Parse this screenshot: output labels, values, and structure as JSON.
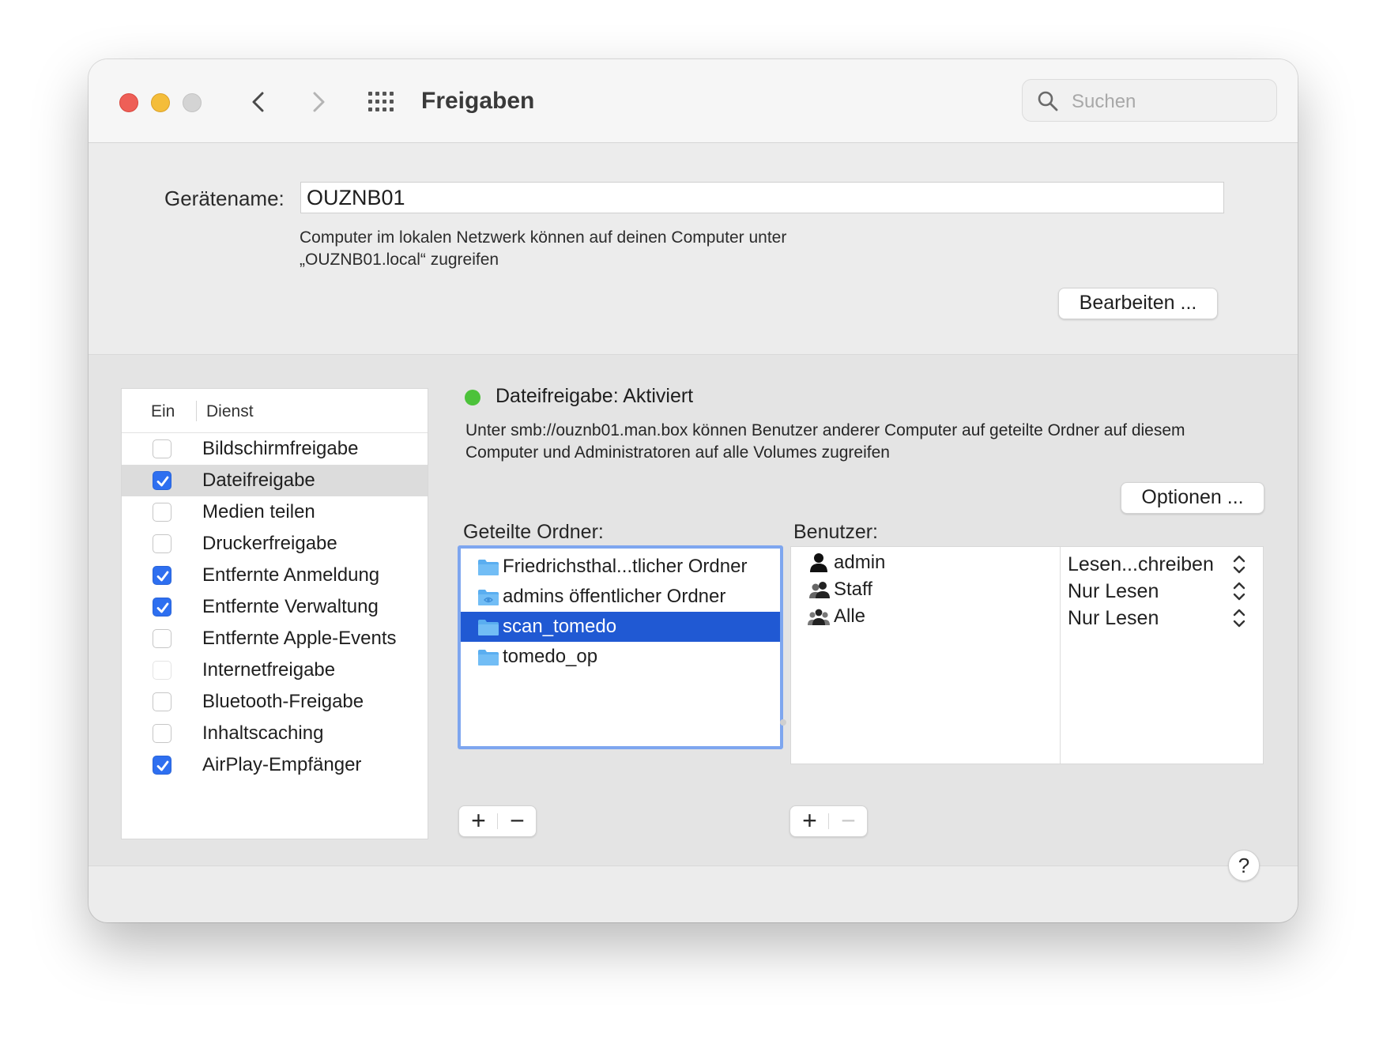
{
  "window": {
    "title": "Freigaben",
    "search_placeholder": "Suchen"
  },
  "device": {
    "label": "Gerätename:",
    "name": "OUZNB01",
    "description": "Computer im lokalen Netzwerk können auf deinen Computer unter „OUZNB01.local“ zugreifen",
    "edit_button": "Bearbeiten ..."
  },
  "services": {
    "header_on": "Ein",
    "header_service": "Dienst",
    "items": [
      {
        "label": "Bildschirmfreigabe",
        "checked": false
      },
      {
        "label": "Dateifreigabe",
        "checked": true
      },
      {
        "label": "Medien teilen",
        "checked": false
      },
      {
        "label": "Druckerfreigabe",
        "checked": false
      },
      {
        "label": "Entfernte Anmeldung",
        "checked": true
      },
      {
        "label": "Entfernte Verwaltung",
        "checked": true
      },
      {
        "label": "Entfernte Apple-Events",
        "checked": false
      },
      {
        "label": "Internetfreigabe",
        "checked": false
      },
      {
        "label": "Bluetooth-Freigabe",
        "checked": false
      },
      {
        "label": "Inhaltscaching",
        "checked": false
      },
      {
        "label": "AirPlay-Empfänger",
        "checked": true
      }
    ]
  },
  "detail": {
    "status": "Dateifreigabe: Aktiviert",
    "status_color": "#4cc23a",
    "info": "Unter smb://ouznb01.man.box können Benutzer anderer Computer auf geteilte Ordner auf diesem Computer und Administratoren auf alle Volumes zugreifen",
    "options_button": "Optionen ...",
    "folders_label": "Geteilte Ordner:",
    "users_label": "Benutzer:",
    "folders": [
      {
        "name": "Friedrichsthal...tlicher Ordner",
        "icon": "folder-icon"
      },
      {
        "name": "admins öffentlicher Ordner",
        "icon": "public-folder-icon"
      },
      {
        "name": "scan_tomedo",
        "icon": "folder-icon"
      },
      {
        "name": "tomedo_op",
        "icon": "folder-icon"
      }
    ],
    "users": [
      {
        "name": "admin",
        "permission": "Lesen...chreiben",
        "icon": "user-icon"
      },
      {
        "name": "Staff",
        "permission": "Nur Lesen",
        "icon": "group-icon"
      },
      {
        "name": "Alle",
        "permission": "Nur Lesen",
        "icon": "everyone-icon"
      }
    ],
    "add_symbol": "+",
    "remove_symbol": "−"
  },
  "help_label": "?",
  "colors": {
    "accent": "#2e6ff0",
    "selection": "#2059d3",
    "focus_ring": "#7ea6ef"
  }
}
